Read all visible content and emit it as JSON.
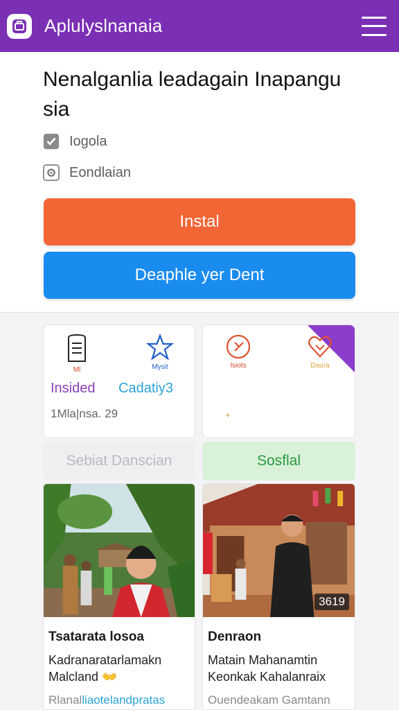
{
  "appbar": {
    "title": "Aplulyslnanaia",
    "logo_icon": "app-logo-icon",
    "menu_icon": "hamburger-menu-icon",
    "color": "#7b2fb5"
  },
  "hero": {
    "title": "Nenalganlia leadagain Inapangu sia",
    "features": [
      {
        "icon": "checkbox-checked-icon",
        "label": "Iogola"
      },
      {
        "icon": "settings-icon",
        "label": "Eondlaian"
      }
    ],
    "install_label": "Instal",
    "deploy_label": "Deaphle yer Dent"
  },
  "cards": {
    "left": {
      "icons": [
        {
          "icon": "document-icon",
          "label": "Ml"
        },
        {
          "icon": "star-icon",
          "label": "Mysit"
        }
      ],
      "left_text": "Insided",
      "right_text": "Cadatiy3",
      "meta": "1Mla|nsa. 29"
    },
    "right": {
      "icons": [
        {
          "icon": "chat-icon",
          "label": "Isiots"
        },
        {
          "icon": "heart-icon",
          "label": "Daura"
        }
      ],
      "sparkle": "+"
    }
  },
  "pills": {
    "left": "Sebiat Danscian",
    "right": "Sosflal"
  },
  "feed": [
    {
      "title": "Tsatarata losoa",
      "desc": "Kadranaratarlamakn Malcland 👐",
      "foot_plain": "Rlanal",
      "foot_link": "liaotelandpratas"
    },
    {
      "title": "Denraon",
      "desc": "Matain Mahanamtin Keonkak Kahalanraix",
      "foot_plain": "Ouendeakam Gamtann",
      "foot_link": "",
      "badge": "3619"
    }
  ],
  "colors": {
    "install": "#f26535",
    "deploy": "#1a8cf0",
    "accent": "#8a3ccb",
    "success": "#2a9a3f"
  }
}
